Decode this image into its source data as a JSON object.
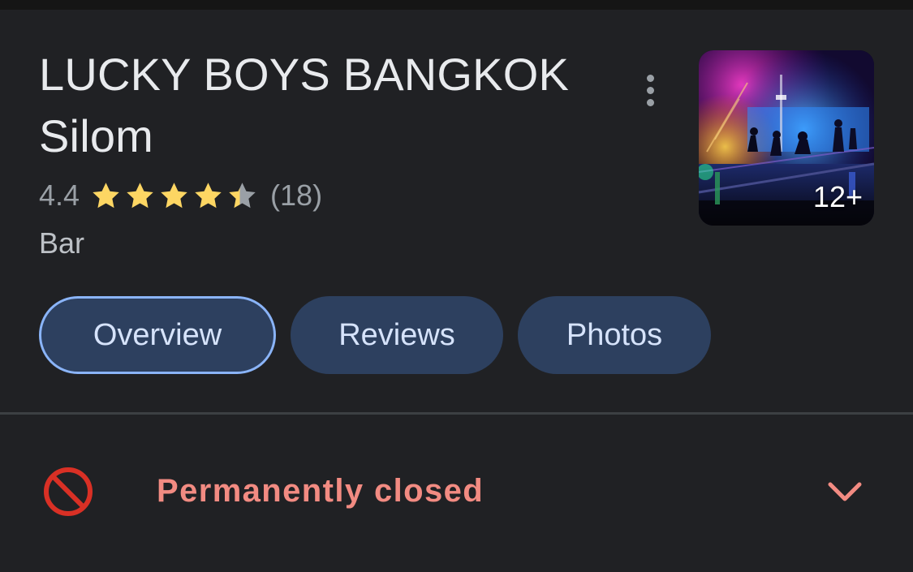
{
  "place": {
    "name": "LUCKY BOYS BANGKOK Silom",
    "rating": "4.4",
    "stars_value": 4.4,
    "stars_max": 5,
    "review_count": "(18)",
    "category": "Bar",
    "photo_count": "12+"
  },
  "icons": {
    "more": "more-vert-icon",
    "star": "star-icon",
    "closed": "block-icon",
    "expand": "chevron-down-icon"
  },
  "tabs": [
    {
      "label": "Overview",
      "selected": true
    },
    {
      "label": "Reviews",
      "selected": false
    },
    {
      "label": "Photos",
      "selected": false
    }
  ],
  "status": {
    "text": "Permanently closed"
  },
  "colors": {
    "background": "#202124",
    "star": "#fdd663",
    "star_empty": "#9aa0a6",
    "status": "#f28b82",
    "status_icon": "#d93025",
    "tab_fill": "#2d405f",
    "tab_selected_border": "#8ab4f8"
  }
}
